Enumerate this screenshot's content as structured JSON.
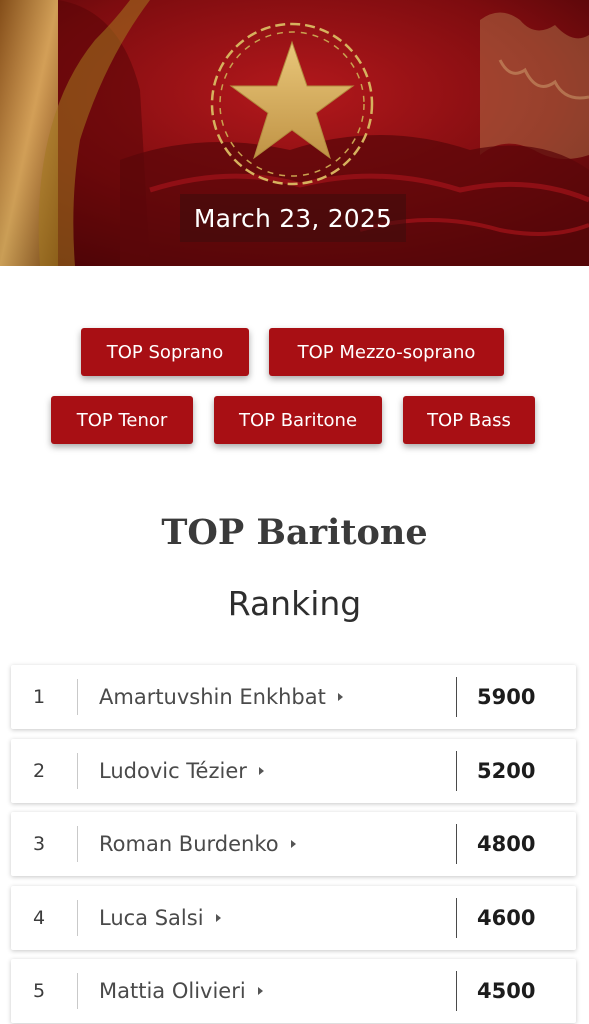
{
  "header": {
    "date": "March 23, 2025",
    "logo_icon": "gold-star-laurel-wreath-icon"
  },
  "categories": [
    {
      "label": "TOP Soprano",
      "selected": false
    },
    {
      "label": "TOP Mezzo-soprano",
      "selected": false
    },
    {
      "label": "TOP Tenor",
      "selected": false
    },
    {
      "label": "TOP Baritone",
      "selected": true
    },
    {
      "label": "TOP Bass",
      "selected": false
    }
  ],
  "ranking": {
    "title": "TOP Baritone",
    "subtitle": "Ranking",
    "rows": [
      {
        "position": "1",
        "name": "Amartuvshin Enkhbat",
        "score": "5900"
      },
      {
        "position": "2",
        "name": "Ludovic Tézier",
        "score": "5200"
      },
      {
        "position": "3",
        "name": "Roman Burdenko",
        "score": "4800"
      },
      {
        "position": "4",
        "name": "Luca Salsi",
        "score": "4600"
      },
      {
        "position": "5",
        "name": "Mattia Olivieri",
        "score": "4500"
      }
    ]
  },
  "colors": {
    "accent": "#a80f14",
    "banner_red": "#8b1014",
    "gold": "#d6b25e"
  }
}
